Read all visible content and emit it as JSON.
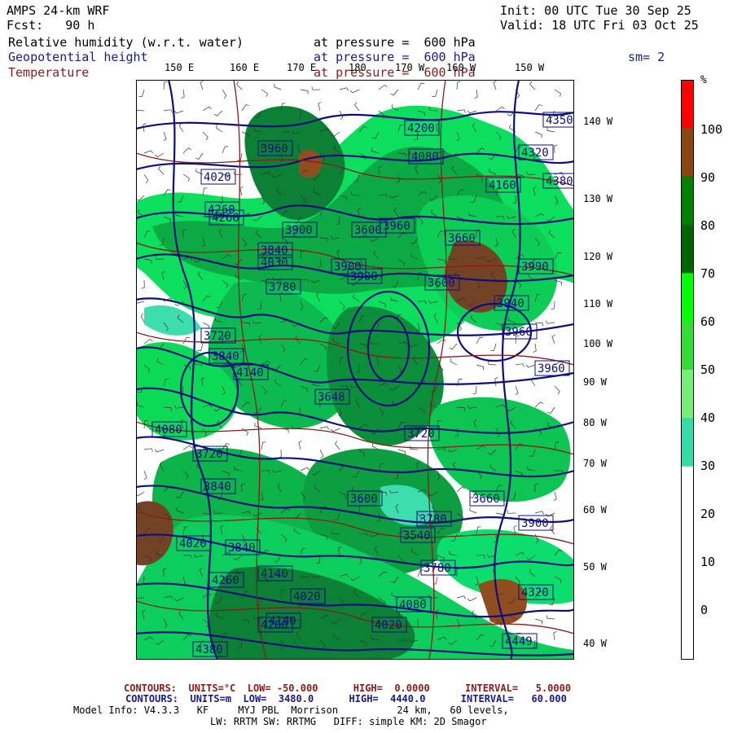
{
  "header": {
    "model": "AMPS 24-km WRF",
    "fcst": "Fcst:   90 h",
    "init": "Init: 00 UTC Tue 30 Sep 25",
    "valid": "Valid: 18 UTC Fri 03 Oct 25",
    "var1_name": "Relative humidity (w.r.t. water)",
    "var1_level": "at pressure =  600 hPa",
    "var2_name": "Geopotential height",
    "var2_level": "at pressure =  600 hPa",
    "var3_name": "Temperature",
    "var3_level": "at pressure =  600 hPa",
    "smoothing": "sm= 2"
  },
  "lon_labels": [
    "150 E",
    "160 E",
    "170 E",
    "180",
    "170 W",
    "160 W",
    "150 W"
  ],
  "lat_labels": [
    "140 W",
    "130 W",
    "120 W",
    "110 W",
    "100 W",
    "90 W",
    "80 W",
    "70 W",
    "60 W",
    "50 W",
    "40 W"
  ],
  "height_labels": [
    "4260",
    "4200",
    "4350",
    "4080",
    "4140",
    "4320",
    "4160",
    "4380",
    "3960",
    "4020",
    "4260",
    "3900",
    "3840",
    "4030",
    "3780",
    "3900",
    "3960",
    "3720",
    "3840",
    "3660",
    "3990",
    "3940",
    "3960",
    "3720",
    "3600",
    "3900",
    "3600",
    "3648",
    "3720",
    "3600",
    "3840",
    "4080",
    "3840",
    "3540",
    "4020",
    "3780",
    "3660",
    "3900",
    "3960",
    "4320",
    "3780",
    "4020",
    "4140",
    "4260",
    "4140",
    "4380",
    "4020",
    "4080",
    "4200",
    "4449"
  ],
  "colorbar": {
    "unit": "%",
    "ticks": [
      "100",
      "90",
      "80",
      "70",
      "60",
      "50",
      "40",
      "30",
      "20",
      "10",
      "0"
    ],
    "colors": [
      "#ff0000",
      "#8b4513",
      "#008000",
      "#006400",
      "#00ff00",
      "#33dd33",
      "#77ee77",
      "#33ddaa",
      "#ffffff",
      "#ffffff",
      "#ffffff",
      "#ffffff"
    ]
  },
  "footer": {
    "temp_contours": "CONTOURS:  UNITS=°C  LOW= -50.000      HIGH=  0.0000      INTERVAL=   5.0000",
    "height_contours": "CONTOURS:  UNITS=m  LOW=  3480.0      HIGH=  4440.0      INTERVAL=   60.000",
    "model_info1": "Model Info: V4.3.3   KF     MYJ PBL  Morrison          24 km,   60 levels,",
    "model_info2": "LW: RRTM SW: RRTMG   DIFF: simple KM: 2D Smagor"
  }
}
